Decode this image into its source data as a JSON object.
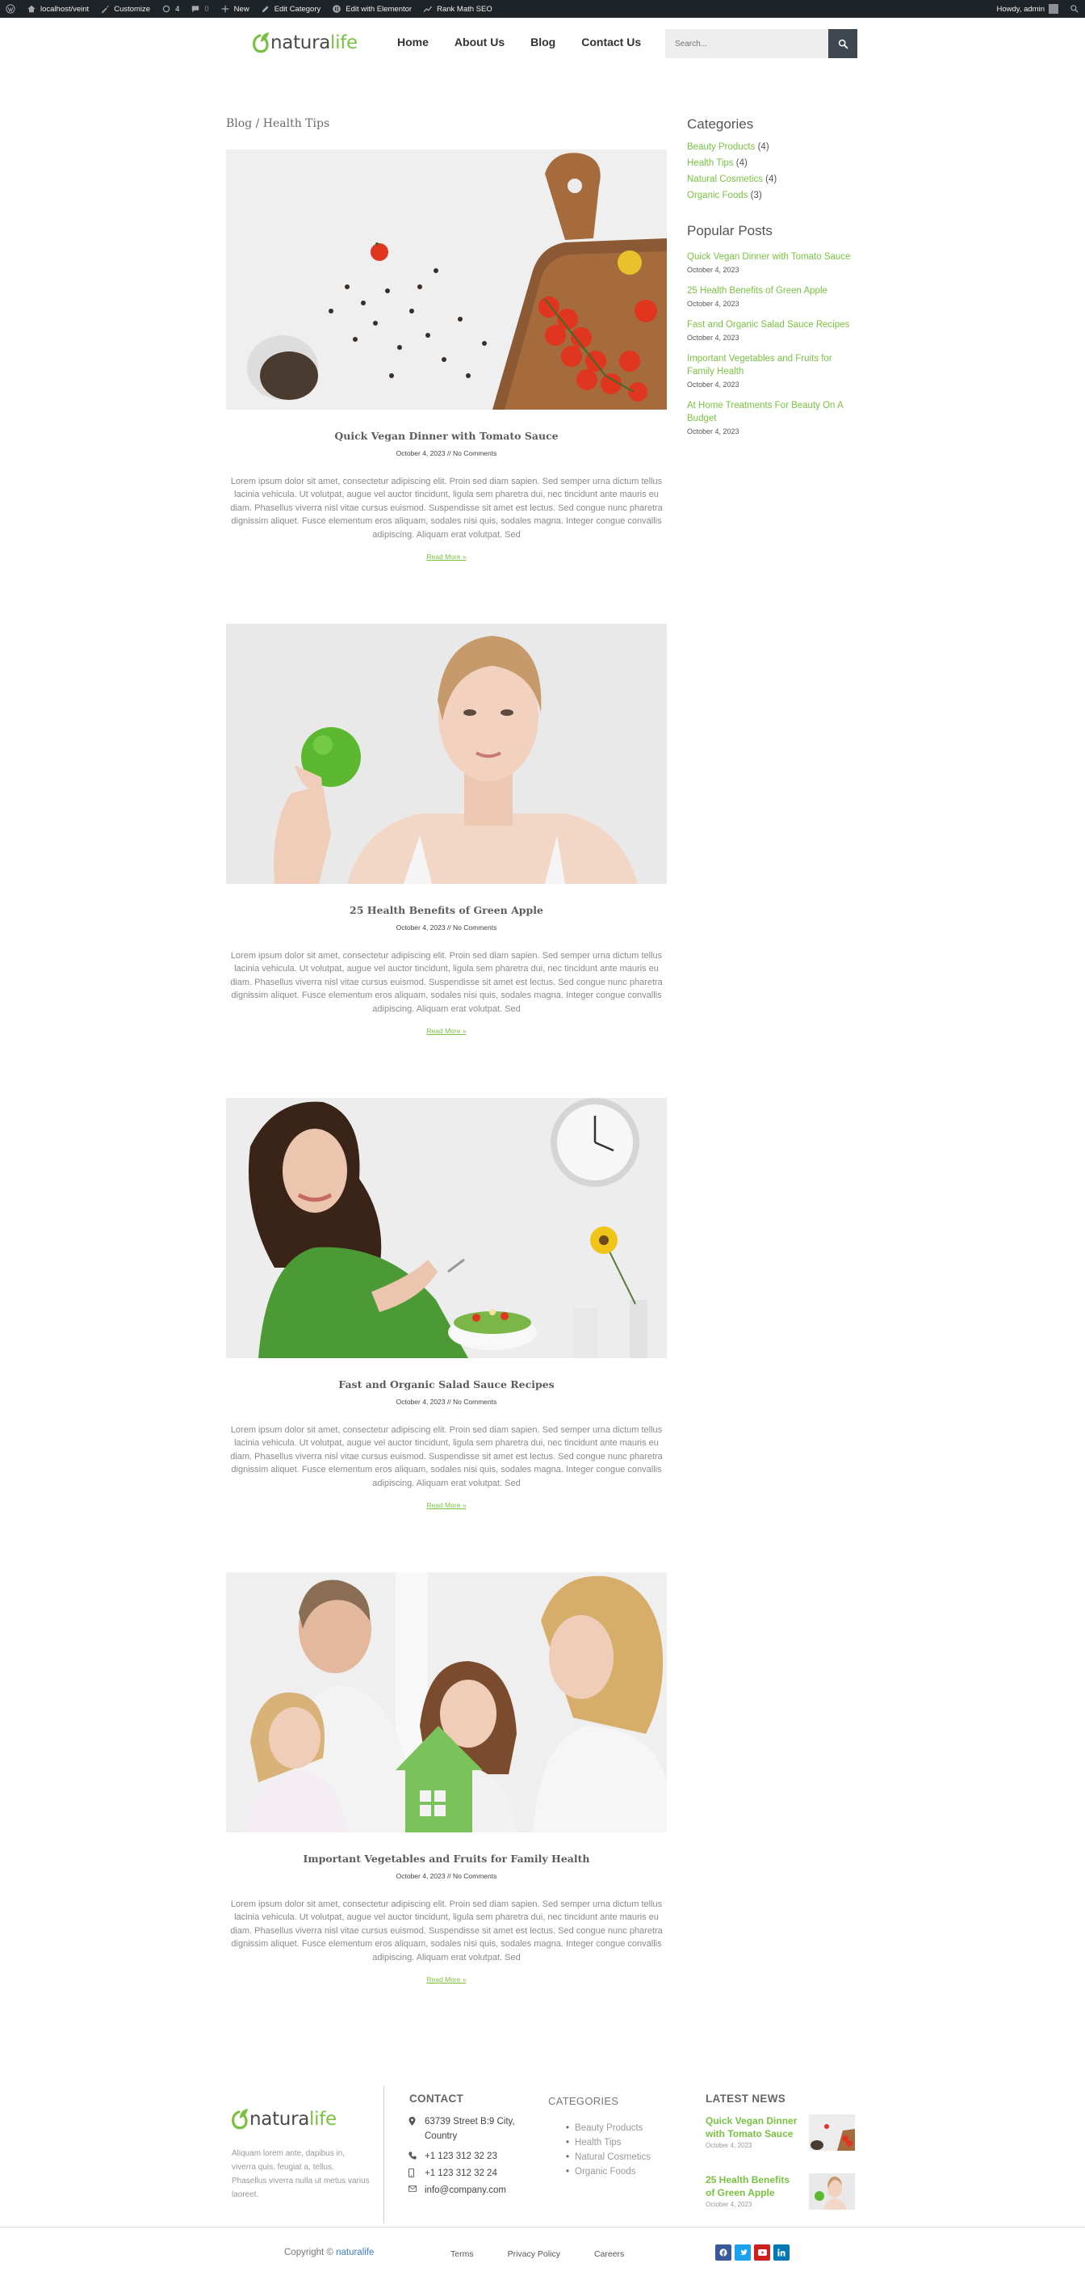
{
  "admin_bar": {
    "site": "localhost/veint",
    "customize": "Customize",
    "updates": "4",
    "comments": "0",
    "new": "New",
    "edit_category": "Edit Category",
    "edit_elementor": "Edit with Elementor",
    "rank_math": "Rank Math SEO",
    "howdy": "Howdy, admin"
  },
  "header": {
    "logo_part1": "natura",
    "logo_part2": "life",
    "nav": [
      "Home",
      "About Us",
      "Blog",
      "Contact Us"
    ],
    "search_placeholder": "Search..."
  },
  "breadcrumb": "Blog / Health Tips",
  "posts": [
    {
      "title": "Quick Vegan Dinner with Tomato Sauce",
      "meta": "October 4, 2023 // No Comments",
      "excerpt": "Lorem ipsum dolor sit amet, consectetur adipiscing elit. Proin sed diam sapien. Sed semper urna dictum tellus lacinia vehicula. Ut volutpat, augue vel auctor tincidunt, ligula sem pharetra dui, nec tincidunt ante mauris eu diam. Phasellus viverra nisl vitae cursus euismod. Suspendisse sit amet est lectus. Sed congue nunc pharetra dignissim aliquet. Fusce elementum eros aliquam, sodales nisi quis, sodales magna. Integer congue convallis adipiscing. Aliquam erat volutpat. Sed",
      "read_more": "Read More »",
      "image": "cutting-board-tomatoes"
    },
    {
      "title": "25 Health Benefits of Green Apple",
      "meta": "October 4, 2023 // No Comments",
      "excerpt": "Lorem ipsum dolor sit amet, consectetur adipiscing elit. Proin sed diam sapien. Sed semper urna dictum tellus lacinia vehicula. Ut volutpat, augue vel auctor tincidunt, ligula sem pharetra dui, nec tincidunt ante mauris eu diam. Phasellus viverra nisl vitae cursus euismod. Suspendisse sit amet est lectus. Sed congue nunc pharetra dignissim aliquet. Fusce elementum eros aliquam, sodales nisi quis, sodales magna. Integer congue convallis adipiscing. Aliquam erat volutpat. Sed",
      "read_more": "Read More »",
      "image": "woman-green-apple"
    },
    {
      "title": "Fast and Organic Salad Sauce Recipes",
      "meta": "October 4, 2023 // No Comments",
      "excerpt": "Lorem ipsum dolor sit amet, consectetur adipiscing elit. Proin sed diam sapien. Sed semper urna dictum tellus lacinia vehicula. Ut volutpat, augue vel auctor tincidunt, ligula sem pharetra dui, nec tincidunt ante mauris eu diam. Phasellus viverra nisl vitae cursus euismod. Suspendisse sit amet est lectus. Sed congue nunc pharetra dignissim aliquet. Fusce elementum eros aliquam, sodales nisi quis, sodales magna. Integer congue convallis adipiscing. Aliquam erat volutpat. Sed",
      "read_more": "Read More »",
      "image": "woman-salad"
    },
    {
      "title": "Important Vegetables and Fruits for Family Health",
      "meta": "October 4, 2023 // No Comments",
      "excerpt": "Lorem ipsum dolor sit amet, consectetur adipiscing elit. Proin sed diam sapien. Sed semper urna dictum tellus lacinia vehicula. Ut volutpat, augue vel auctor tincidunt, ligula sem pharetra dui, nec tincidunt ante mauris eu diam. Phasellus viverra nisl vitae cursus euismod. Suspendisse sit amet est lectus. Sed congue nunc pharetra dignissim aliquet. Fusce elementum eros aliquam, sodales nisi quis, sodales magna. Integer congue convallis adipiscing. Aliquam erat volutpat. Sed",
      "read_more": "Read More »",
      "image": "family-house"
    }
  ],
  "sidebar": {
    "categories_title": "Categories",
    "categories": [
      {
        "name": "Beauty Products",
        "count": "(4)"
      },
      {
        "name": "Health Tips",
        "count": "(4)"
      },
      {
        "name": "Natural Cosmetics",
        "count": "(4)"
      },
      {
        "name": "Organic Foods",
        "count": "(3)"
      }
    ],
    "popular_title": "Popular Posts",
    "popular": [
      {
        "title": "Quick Vegan Dinner with Tomato Sauce",
        "date": "October 4, 2023"
      },
      {
        "title": "25 Health Benefits of Green Apple",
        "date": "October 4, 2023"
      },
      {
        "title": "Fast and Organic Salad Sauce Recipes",
        "date": "October 4, 2023"
      },
      {
        "title": "Important Vegetables and Fruits for Family Health",
        "date": "October 4, 2023"
      },
      {
        "title": "At Home Treatments For Beauty On A Budget",
        "date": "October 4, 2023"
      }
    ]
  },
  "footer": {
    "about": "Aliquam lorem ante, dapibus in, viverra quis, feugiat a, tellus. Phasellus viverra nulla ut metus varius laoreet.",
    "contact_title": "CONTACT",
    "address": "63739 Street B:9 City, Country",
    "phone1": "+1 123 312 32 23",
    "phone2": "+1 123 312 32 24",
    "email": "info@company.com",
    "categories_title": "CATEGORIES",
    "categories": [
      "Beauty Products",
      "Health Tips",
      "Natural Cosmetics",
      "Organic Foods"
    ],
    "news_title": "LATEST NEWS",
    "news": [
      {
        "title": "Quick Vegan Dinner with Tomato Sauce",
        "date": "October 4, 2023"
      },
      {
        "title": "25 Health Benefits of Green Apple",
        "date": "October 4, 2023"
      }
    ],
    "copyright_prefix": "Copyright ©",
    "copyright_brand": "naturalife",
    "links": [
      "Terms",
      "Privacy Policy",
      "Careers"
    ],
    "social": [
      "facebook-icon",
      "twitter-icon",
      "youtube-icon",
      "linkedin-icon"
    ],
    "social_colors": [
      "#3b5998",
      "#1da1f2",
      "#cd201f",
      "#0077b5"
    ]
  },
  "colors": {
    "accent": "#7ac143",
    "admin_bar": "#1d2327",
    "search_button": "#3f4850"
  }
}
